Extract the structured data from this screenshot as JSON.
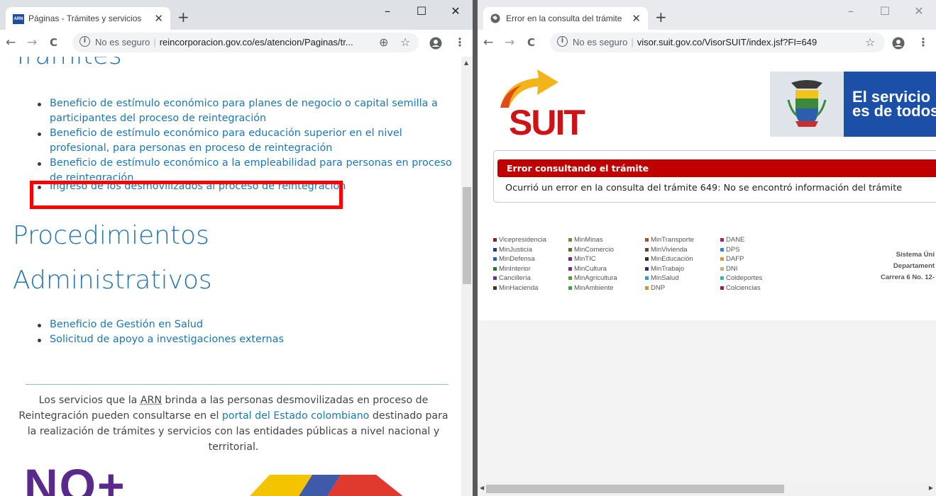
{
  "left_window": {
    "tab": {
      "favicon_text": "ARN",
      "title": "Páginas - Trámites y servicios",
      "close": "✕"
    },
    "new_tab": "+",
    "controls": {
      "minimize": "–",
      "maximize": "☐",
      "close": "✕"
    },
    "toolbar": {
      "back": "←",
      "forward": "→",
      "reload": "C",
      "security": "No es seguro",
      "url": "reincorporacion.gov.co/es/atencion/Paginas/tr...",
      "zoom": "⊕",
      "star": "☆",
      "menu": "⋮"
    },
    "page": {
      "tramites_heading": "Trámites",
      "tramites_items": [
        "Beneficio de estímulo económico para planes de negocio o capital semilla a participantes del proceso de reintegración",
        "Beneficio de estímulo económico para educación superior en el nivel profesional, para personas en proceso de reintegración",
        "Beneficio de estímulo económico a la empleabilidad para personas en proceso de reintegración",
        "Ingreso de los desmovilizados al proceso de reintegración"
      ],
      "procedimientos_heading_1": "Procedimientos",
      "procedimientos_heading_2": "Administrativos",
      "procedimientos_items": [
        "Beneficio de Gestión en Salud",
        "Solicitud de apoyo a investigaciones externas"
      ],
      "paragraph": {
        "part1": "Los servicios que la ",
        "abbr": "ARN",
        "part2": " brinda a las personas desmovilizadas en proceso de Reintegración pueden consultarse en el ",
        "link": "portal del Estado colombiano",
        "part3": " destinado para la realización de trámites y servicios con las entidades públicas a nivel nacional y territorial."
      },
      "logo_text": "NO+"
    }
  },
  "right_window": {
    "tab": {
      "title": "Error en la consulta del trámite",
      "close": "✕"
    },
    "new_tab": "+",
    "controls": {
      "minimize": "–",
      "maximize": "☐",
      "close": "✕"
    },
    "toolbar": {
      "back": "←",
      "forward": "→",
      "reload": "C",
      "security": "No es seguro",
      "url": "visor.suit.gov.co/VisorSUIT/index.jsf?FI=649",
      "star": "☆",
      "menu": "⋮"
    },
    "page": {
      "logo": "SUIT",
      "gov_banner_line1": "El servicio",
      "gov_banner_line2": "es de todos",
      "error_title": "Error consultando el trámite",
      "error_message": "Ocurrió un error en la consulta del trámite 649: No se encontró información del trámite",
      "entities": [
        [
          {
            "name": "Vicepresidencia",
            "color": "#a01717"
          },
          {
            "name": "MinJusticia",
            "color": "#1a3d8f"
          },
          {
            "name": "MinDefensa",
            "color": "#2a5fb0"
          },
          {
            "name": "MinInterior",
            "color": "#1e7a2e"
          },
          {
            "name": "Cancillería",
            "color": "#6a2e9a"
          },
          {
            "name": "MinHacienda",
            "color": "#5c2a12"
          }
        ],
        [
          {
            "name": "MinMinas",
            "color": "#6b8e23"
          },
          {
            "name": "MinComercio",
            "color": "#4a7a1e"
          },
          {
            "name": "MinTIC",
            "color": "#7a1f86"
          },
          {
            "name": "MinCultura",
            "color": "#7a2a7a"
          },
          {
            "name": "MinAgricultura",
            "color": "#5a9a1e"
          },
          {
            "name": "MinAmbiente",
            "color": "#34a83a"
          }
        ],
        [
          {
            "name": "MinTransporte",
            "color": "#a0522d"
          },
          {
            "name": "MinVivienda",
            "color": "#6b4423"
          },
          {
            "name": "MinEducación",
            "color": "#3d2a1e"
          },
          {
            "name": "MinTrabajo",
            "color": "#2a2a8a"
          },
          {
            "name": "MinSalud",
            "color": "#2aa0c8"
          },
          {
            "name": "DNP",
            "color": "#c89a1e"
          }
        ],
        [
          {
            "name": "DANE",
            "color": "#c0185a"
          },
          {
            "name": "DPS",
            "color": "#2a8ad8"
          },
          {
            "name": "DAFP",
            "color": "#d0a020"
          },
          {
            "name": "DNI",
            "color": "#c8b080"
          },
          {
            "name": "Coldeportes",
            "color": "#30b8b0"
          },
          {
            "name": "Colciencias",
            "color": "#8a1e6a"
          }
        ]
      ],
      "footer_address": [
        "Sistema Úni",
        "Departament",
        "Carrera 6 No. 12-"
      ]
    }
  }
}
